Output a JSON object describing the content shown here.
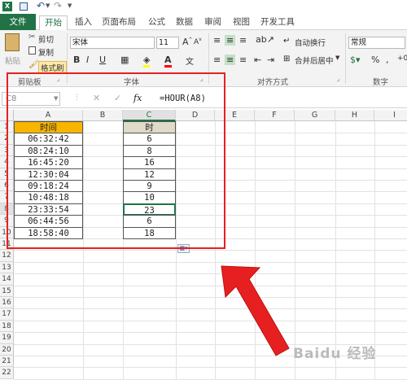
{
  "titlebar": {
    "excel_icon": "excel-icon",
    "save_icon": "save-icon",
    "undo_icon": "undo-icon",
    "redo_icon": "redo-icon"
  },
  "menu": {
    "file": "文件",
    "tabs": [
      "开始",
      "插入",
      "页面布局",
      "公式",
      "数据",
      "审阅",
      "视图",
      "开发工具"
    ]
  },
  "ribbon": {
    "paste": "粘贴",
    "cut": "剪切",
    "copy": "复制",
    "format_painter": "格式刷",
    "font_name": "宋体",
    "font_size": "11",
    "wrap_text": "自动换行",
    "merge_center": "合并后居中",
    "number_format": "常规",
    "groups": {
      "clipboard": "剪贴板",
      "font": "字体",
      "alignment": "对齐方式",
      "number": "数字"
    }
  },
  "formula_bar": {
    "name_box": "C8",
    "fx": "fx",
    "formula": "=HOUR(A8)"
  },
  "columns": [
    "A",
    "B",
    "C",
    "D",
    "E",
    "F",
    "G",
    "H",
    "I"
  ],
  "rows": [
    "1",
    "2",
    "3",
    "4",
    "5",
    "6",
    "7",
    "8",
    "9",
    "10",
    "11",
    "12",
    "13",
    "14",
    "15",
    "16",
    "17",
    "18",
    "19",
    "20",
    "21",
    "22"
  ],
  "table": {
    "header_a": "时间",
    "header_c": "时",
    "times": [
      "06:32:42",
      "08:24:10",
      "16:45:20",
      "12:30:04",
      "09:18:24",
      "10:48:18",
      "23:33:54",
      "06:44:56",
      "18:58:40"
    ],
    "hours": [
      "6",
      "8",
      "16",
      "12",
      "9",
      "10",
      "23",
      "6",
      "18"
    ]
  },
  "watermark": "Baidu 经验",
  "colors": {
    "excel_green": "#217346",
    "header_a_fill": "#f7b500",
    "header_c_fill": "#e0dac8",
    "highlight_red": "#e62020"
  }
}
